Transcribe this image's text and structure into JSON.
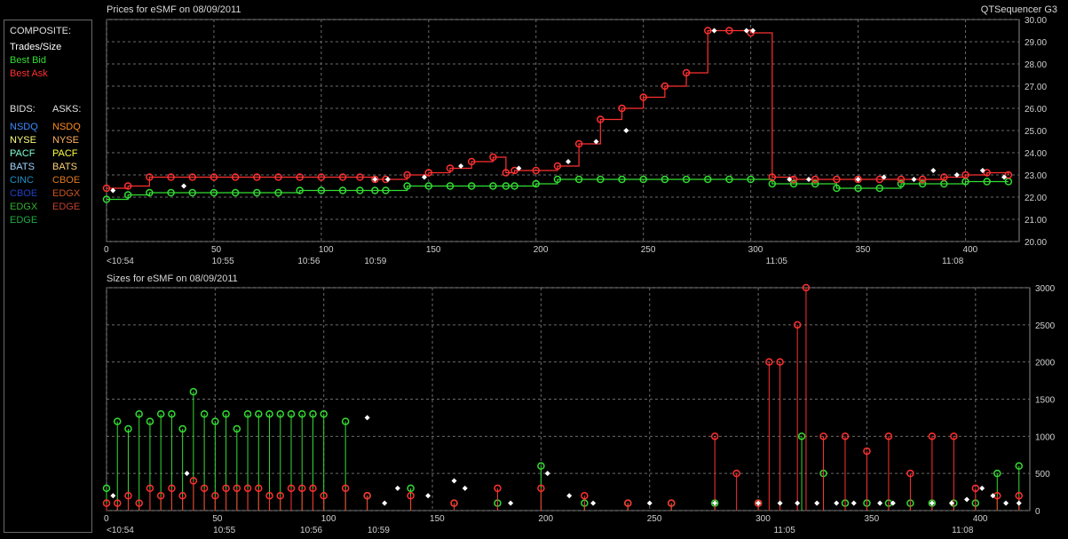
{
  "app_title": "QTSequencer G3",
  "prices_title": "Prices for  eSMF  on  08/09/2011",
  "sizes_title": "Sizes for  eSMF  on  08/09/2011",
  "legend": {
    "composite_header": "COMPOSITE:",
    "composite": [
      {
        "label": "Trades/Size",
        "color": "#ffffff"
      },
      {
        "label": "Best Bid",
        "color": "#33dd33"
      },
      {
        "label": "Best Ask",
        "color": "#ff3030"
      }
    ],
    "bids_header": "BIDS:",
    "asks_header": "ASKS:",
    "bids": [
      {
        "label": "NSDQ",
        "color": "#3a8cff"
      },
      {
        "label": "NYSE",
        "color": "#ffff80"
      },
      {
        "label": "PACF",
        "color": "#7dffd0"
      },
      {
        "label": "BATS",
        "color": "#9fd4ff"
      },
      {
        "label": "CINC",
        "color": "#1e90c8"
      },
      {
        "label": "CBOE",
        "color": "#2040c0"
      },
      {
        "label": "EDGX",
        "color": "#30b030"
      },
      {
        "label": "EDGE",
        "color": "#22aa44"
      }
    ],
    "asks": [
      {
        "label": "NSDQ",
        "color": "#ff8c1a"
      },
      {
        "label": "NYSE",
        "color": "#ffb060"
      },
      {
        "label": "PACF",
        "color": "#ffff40"
      },
      {
        "label": "BATS",
        "color": "#ffd27a"
      },
      {
        "label": "CBOE",
        "color": "#e07a20"
      },
      {
        "label": "EDGX",
        "color": "#cc5520"
      },
      {
        "label": "EDGE",
        "color": "#c04030"
      }
    ]
  },
  "chart_data": [
    {
      "type": "line",
      "title": "Prices for  eSMF  on  08/09/2011",
      "xlim": [
        0,
        425
      ],
      "ylim": [
        20,
        30
      ],
      "grid": true,
      "x_ticks": [
        0,
        50,
        100,
        150,
        200,
        250,
        300,
        350,
        400
      ],
      "y_ticks": [
        "20.00",
        "21.00",
        "22.00",
        "23.00",
        "24.00",
        "25.00",
        "26.00",
        "27.00",
        "28.00",
        "29.00",
        "30.00"
      ],
      "time_ticks": [
        {
          "x": 0,
          "label": "<10:54"
        },
        {
          "x": 54,
          "label": "10:55"
        },
        {
          "x": 94,
          "label": "10:56"
        },
        {
          "x": 125,
          "label": "10:59"
        },
        {
          "x": 312,
          "label": "11:05"
        },
        {
          "x": 394,
          "label": "11:08"
        }
      ],
      "series": [
        {
          "name": "Best Bid",
          "color": "#33dd33",
          "x": [
            0,
            10,
            20,
            30,
            40,
            50,
            60,
            70,
            80,
            90,
            100,
            110,
            118,
            125,
            130,
            140,
            150,
            160,
            170,
            180,
            186,
            190,
            200,
            210,
            220,
            230,
            240,
            250,
            260,
            270,
            280,
            290,
            300,
            310,
            320,
            330,
            340,
            350,
            360,
            370,
            380,
            390,
            400,
            410,
            420
          ],
          "y": [
            21.9,
            22.1,
            22.2,
            22.2,
            22.2,
            22.2,
            22.2,
            22.2,
            22.2,
            22.3,
            22.3,
            22.3,
            22.3,
            22.3,
            22.3,
            22.5,
            22.5,
            22.5,
            22.5,
            22.5,
            22.5,
            22.5,
            22.6,
            22.8,
            22.8,
            22.8,
            22.8,
            22.8,
            22.8,
            22.8,
            22.8,
            22.8,
            22.8,
            22.6,
            22.6,
            22.6,
            22.4,
            22.4,
            22.4,
            22.6,
            22.6,
            22.6,
            22.7,
            22.7,
            22.7
          ]
        },
        {
          "name": "Best Ask",
          "color": "#ff3030",
          "x": [
            0,
            10,
            20,
            30,
            40,
            50,
            60,
            70,
            80,
            90,
            100,
            110,
            118,
            125,
            130,
            140,
            150,
            160,
            170,
            180,
            186,
            190,
            200,
            210,
            220,
            230,
            240,
            250,
            260,
            270,
            280,
            290,
            300,
            310,
            320,
            330,
            340,
            350,
            360,
            370,
            380,
            390,
            400,
            410,
            420
          ],
          "y": [
            22.4,
            22.5,
            22.9,
            22.9,
            22.9,
            22.9,
            22.9,
            22.9,
            22.9,
            22.9,
            22.9,
            22.9,
            22.9,
            22.8,
            22.8,
            23.0,
            23.1,
            23.3,
            23.6,
            23.8,
            23.1,
            23.2,
            23.2,
            23.4,
            24.4,
            25.5,
            26.0,
            26.5,
            27.0,
            27.6,
            29.5,
            29.5,
            29.4,
            22.9,
            22.8,
            22.8,
            22.8,
            22.8,
            22.8,
            22.8,
            22.8,
            22.9,
            23.0,
            23.1,
            23.0
          ]
        },
        {
          "name": "Trades/Size",
          "color": "#ffffff",
          "x": [
            3,
            36,
            125,
            131,
            148,
            165,
            192,
            215,
            228,
            242,
            283,
            298,
            301,
            318,
            327,
            350,
            362,
            376,
            385,
            396,
            408,
            418
          ],
          "y": [
            22.3,
            22.5,
            22.8,
            22.8,
            22.9,
            23.4,
            23.3,
            23.6,
            24.5,
            25.0,
            29.5,
            29.5,
            29.5,
            22.8,
            22.8,
            22.8,
            22.9,
            22.8,
            23.2,
            23.0,
            23.2,
            22.9
          ]
        }
      ]
    },
    {
      "type": "bar",
      "title": "Sizes for  eSMF  on  08/09/2011",
      "xlim": [
        0,
        425
      ],
      "ylim": [
        0,
        3000
      ],
      "grid": true,
      "x_ticks": [
        0,
        50,
        100,
        150,
        200,
        250,
        300,
        350,
        400
      ],
      "y_ticks": [
        "0",
        "500",
        "1000",
        "1500",
        "2000",
        "2500",
        "3000"
      ],
      "time_ticks": [
        {
          "x": 0,
          "label": "<10:54"
        },
        {
          "x": 54,
          "label": "10:55"
        },
        {
          "x": 94,
          "label": "10:56"
        },
        {
          "x": 125,
          "label": "10:59"
        },
        {
          "x": 312,
          "label": "11:05"
        },
        {
          "x": 394,
          "label": "11:08"
        }
      ],
      "series": [
        {
          "name": "Best Bid",
          "color": "#33dd33",
          "x": [
            0,
            5,
            10,
            15,
            20,
            25,
            30,
            35,
            40,
            45,
            50,
            55,
            60,
            65,
            70,
            75,
            80,
            85,
            90,
            95,
            100,
            110,
            120,
            140,
            160,
            180,
            200,
            220,
            240,
            260,
            280,
            300,
            320,
            330,
            340,
            350,
            360,
            370,
            380,
            390,
            400,
            410,
            420
          ],
          "values": [
            300,
            1200,
            1100,
            1300,
            1200,
            1300,
            1300,
            1100,
            1600,
            1300,
            1200,
            1300,
            1100,
            1300,
            1300,
            1300,
            1300,
            1300,
            1300,
            1300,
            1300,
            1200,
            200,
            300,
            100,
            100,
            600,
            100,
            100,
            100,
            100,
            100,
            1000,
            500,
            100,
            100,
            100,
            100,
            100,
            100,
            100,
            500,
            600
          ]
        },
        {
          "name": "Best Ask",
          "color": "#ff3030",
          "x": [
            0,
            5,
            10,
            15,
            20,
            25,
            30,
            35,
            40,
            45,
            50,
            55,
            60,
            65,
            70,
            75,
            80,
            85,
            90,
            95,
            100,
            110,
            120,
            140,
            160,
            180,
            200,
            220,
            240,
            260,
            280,
            290,
            300,
            305,
            310,
            318,
            322,
            330,
            340,
            350,
            360,
            370,
            380,
            390,
            400,
            410,
            420
          ],
          "values": [
            100,
            100,
            200,
            100,
            300,
            200,
            300,
            200,
            400,
            300,
            200,
            300,
            300,
            300,
            300,
            200,
            200,
            300,
            300,
            300,
            200,
            300,
            200,
            200,
            100,
            300,
            300,
            200,
            100,
            100,
            1000,
            500,
            100,
            2000,
            2000,
            2500,
            3000,
            1000,
            1000,
            800,
            1000,
            500,
            1000,
            1000,
            300,
            200,
            200
          ]
        },
        {
          "name": "Trades/Size",
          "color": "#ffffff",
          "x": [
            3,
            37,
            120,
            128,
            134,
            148,
            160,
            165,
            186,
            203,
            213,
            224,
            250,
            280,
            300,
            310,
            318,
            327,
            336,
            344,
            356,
            362,
            380,
            389,
            396,
            403,
            408,
            414,
            420
          ],
          "values": [
            200,
            500,
            1250,
            100,
            300,
            200,
            400,
            300,
            100,
            500,
            200,
            100,
            100,
            100,
            100,
            100,
            100,
            100,
            100,
            100,
            100,
            100,
            100,
            100,
            150,
            300,
            200,
            100,
            100
          ]
        }
      ]
    }
  ]
}
